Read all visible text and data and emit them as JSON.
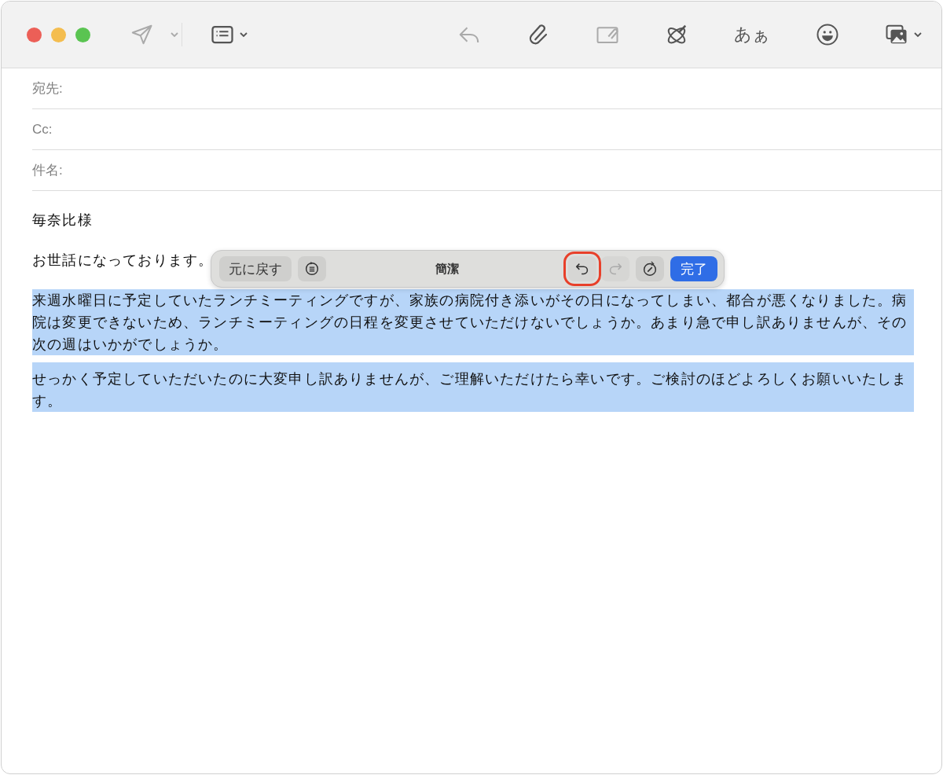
{
  "window": {
    "controls": [
      {
        "color": "#ec5f57"
      },
      {
        "color": "#f4bd4f"
      },
      {
        "color": "#5ac451"
      }
    ]
  },
  "toolbar": {
    "left": [
      {
        "kind": "send",
        "disabled": true,
        "menu": true
      },
      {
        "kind": "header-fields",
        "disabled": false,
        "menu": true
      }
    ],
    "right": [
      {
        "kind": "reply",
        "disabled": true
      },
      {
        "kind": "attach",
        "disabled": false
      },
      {
        "kind": "attach-photo",
        "disabled": true
      },
      {
        "kind": "writing-tools",
        "disabled": false
      },
      {
        "kind": "font",
        "label": "あぁ",
        "disabled": false
      },
      {
        "kind": "emoji",
        "disabled": false
      },
      {
        "kind": "media",
        "disabled": false,
        "menu": true
      }
    ]
  },
  "header_fields": [
    {
      "label": "宛先:"
    },
    {
      "label": "Cc:"
    },
    {
      "label": "件名:"
    }
  ],
  "body": [
    {
      "text": "毎奈比様",
      "selected": false
    },
    {
      "text": "お世話になっております。",
      "selected": false
    },
    {
      "text": "来週水曜日に予定していたランチミーティングですが、家族の病院付き添いがその日になってしまい、都合が悪くなりました。病院は変更できないため、ランチミーティングの日程を変更させていただけないでしょうか。あまり急で申し訳ありませんが、その次の週はいかがでしょうか。",
      "selected": true
    },
    {
      "text": "せっかく予定していただいたのに大変申し訳ありませんが、ご理解いただけたら幸いです。ご検討のほどよろしくお願いいたします。",
      "selected": true
    }
  ],
  "writing_tools_bar": {
    "items": [
      {
        "kind": "text-button",
        "label": "元に戻す"
      },
      {
        "kind": "summary"
      },
      {
        "kind": "title",
        "label": "簡潔"
      },
      {
        "kind": "undo",
        "disabled": false,
        "highlighted": true
      },
      {
        "kind": "redo",
        "disabled": true,
        "highlighted": false
      },
      {
        "kind": "rewrite"
      },
      {
        "kind": "primary",
        "label": "完了"
      }
    ]
  }
}
